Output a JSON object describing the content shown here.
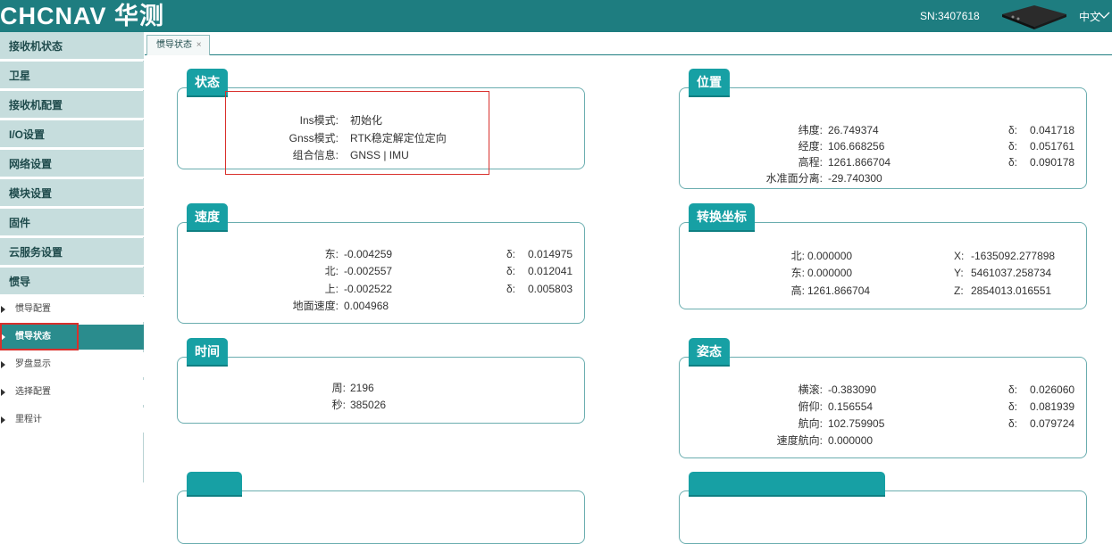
{
  "header": {
    "logo": "CHCNAV 华测",
    "sn": "SN:3407618",
    "lang": "中文",
    "lang_icon": "chevron-down-icon"
  },
  "sidebar": {
    "menu": [
      "接收机状态",
      "卫星",
      "接收机配置",
      "I/O设置",
      "网络设置",
      "模块设置",
      "固件",
      "云服务设置",
      "惯导"
    ],
    "sub": [
      "惯导配置",
      "惯导状态",
      "罗盘显示",
      "选择配置",
      "里程计"
    ],
    "active_sub": "惯导状态"
  },
  "tabs": [
    {
      "label": "惯导状态",
      "close": "×"
    }
  ],
  "panels": {
    "status": {
      "title": "状态",
      "rows": [
        {
          "label": "Ins模式:",
          "value": "初始化"
        },
        {
          "label": "Gnss模式:",
          "value": "RTK稳定解定位定向"
        },
        {
          "label": "组合信息:",
          "value": "GNSS | IMU"
        }
      ]
    },
    "position": {
      "title": "位置",
      "rows": [
        {
          "label": "纬度:",
          "value": "26.749374",
          "dlabel": "δ:",
          "dvalue": "0.041718"
        },
        {
          "label": "经度:",
          "value": "106.668256",
          "dlabel": "δ:",
          "dvalue": "0.051761"
        },
        {
          "label": "高程:",
          "value": "1261.866704",
          "dlabel": "δ:",
          "dvalue": "0.090178"
        },
        {
          "label": "水准面分离:",
          "value": "-29.740300"
        }
      ]
    },
    "velocity": {
      "title": "速度",
      "rows": [
        {
          "label": "东:",
          "value": "-0.004259",
          "dlabel": "δ:",
          "dvalue": "0.014975"
        },
        {
          "label": "北:",
          "value": "-0.002557",
          "dlabel": "δ:",
          "dvalue": "0.012041"
        },
        {
          "label": "上:",
          "value": "-0.002522",
          "dlabel": "δ:",
          "dvalue": "0.005803"
        },
        {
          "label": "地面速度:",
          "value": "0.004968"
        }
      ]
    },
    "coords": {
      "title": "转换坐标",
      "rows": [
        {
          "label": "北:",
          "value": "0.000000",
          "dlabel": "X:",
          "dvalue": "-1635092.277898"
        },
        {
          "label": "东:",
          "value": "0.000000",
          "dlabel": "Y:",
          "dvalue": "5461037.258734"
        },
        {
          "label": "高:",
          "value": "1261.866704",
          "dlabel": "Z:",
          "dvalue": "2854013.016551"
        }
      ]
    },
    "time": {
      "title": "时间",
      "rows": [
        {
          "label": "周:",
          "value": "2196"
        },
        {
          "label": "秒:",
          "value": "385026"
        }
      ]
    },
    "attitude": {
      "title": "姿态",
      "rows": [
        {
          "label": "横滚:",
          "value": "-0.383090",
          "dlabel": "δ:",
          "dvalue": "0.026060"
        },
        {
          "label": "俯仰:",
          "value": "0.156554",
          "dlabel": "δ:",
          "dvalue": "0.081939"
        },
        {
          "label": "航向:",
          "value": "102.759905",
          "dlabel": "δ:",
          "dvalue": "0.079724"
        },
        {
          "label": "速度航向:",
          "value": "0.000000"
        }
      ]
    }
  },
  "colors": {
    "header": "#1e7d80",
    "accent": "#17a0a4",
    "highlight": "#d9302c"
  }
}
